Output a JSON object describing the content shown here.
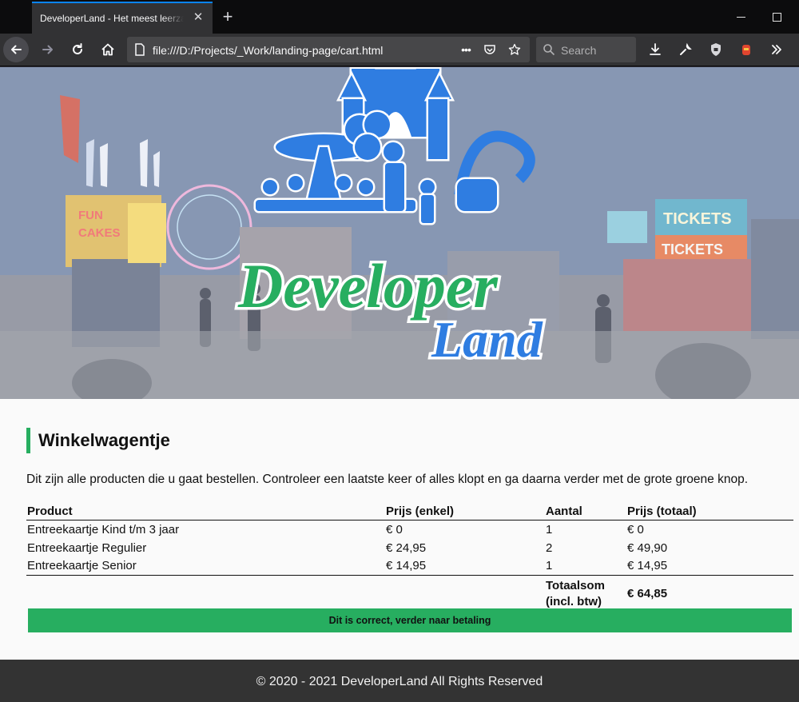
{
  "browser": {
    "tab_title": "DeveloperLand - Het meest leerzame pretpark",
    "tab_close": "✕",
    "new_tab": "+",
    "url": "file:///D:/Projects/_Work/landing-page/cart.html",
    "search_placeholder": "Search",
    "page_actions": "•••"
  },
  "hero": {
    "logo_title": "Developer",
    "logo_subtitle": "Land",
    "colors": {
      "green": "#27ae60",
      "blue": "#2f7de1"
    }
  },
  "cart": {
    "heading": "Winkelwagentje",
    "intro": "Dit zijn alle producten die u gaat bestellen. Controleer een laatste keer of alles klopt en ga daarna verder met de grote groene knop.",
    "columns": [
      "Product",
      "Prijs (enkel)",
      "Aantal",
      "Prijs (totaal)"
    ],
    "rows": [
      {
        "product": "Entreekaartje Kind t/m 3 jaar",
        "unit_price": "€ 0",
        "quantity": "1",
        "total_price": "€ 0"
      },
      {
        "product": "Entreekaartje Regulier",
        "unit_price": "€ 24,95",
        "quantity": "2",
        "total_price": "€ 49,90"
      },
      {
        "product": "Entreekaartje Senior",
        "unit_price": "€ 14,95",
        "quantity": "1",
        "total_price": "€ 14,95"
      }
    ],
    "total_label_1": "Totaalsom",
    "total_label_2": "(incl. btw)",
    "total_value": "€ 64,85",
    "confirm_button": "Dit is correct, verder naar betaling",
    "accent_color": "#27ae60"
  },
  "footer": {
    "copyright": "© 2020 - 2021 DeveloperLand  All Rights Reserved"
  }
}
